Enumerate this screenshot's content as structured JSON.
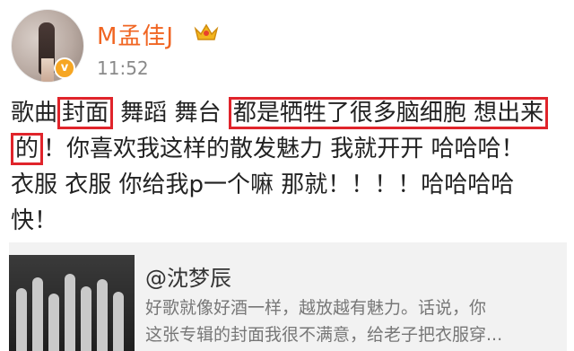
{
  "post": {
    "username": "M孟佳J",
    "timestamp": "11:52",
    "lines": [
      [
        "歌曲",
        "封面",
        " 舞蹈 舞台 ",
        "都是牺牲了很多脑细胞 想出来"
      ],
      [
        "的",
        "！你喜欢我这样的散发魅力 我就开开 哈哈哈！"
      ],
      [
        "衣服 衣服 你给我p一个嘛 那就！！！！哈哈哈哈"
      ],
      [
        "快！"
      ]
    ]
  },
  "repost": {
    "username": "@沈梦辰",
    "lines": [
      "好歌就像好酒一样，越放越有魅力。话说，你",
      "这张专辑的封面我很不满意，给老子把衣服穿..."
    ]
  },
  "colors": {
    "username": "#f06522",
    "highlight_box": "#e0242b",
    "verified_badge": "#f6a623"
  },
  "icons": {
    "verified": "verified-badge-icon",
    "crown": "crown-icon"
  }
}
